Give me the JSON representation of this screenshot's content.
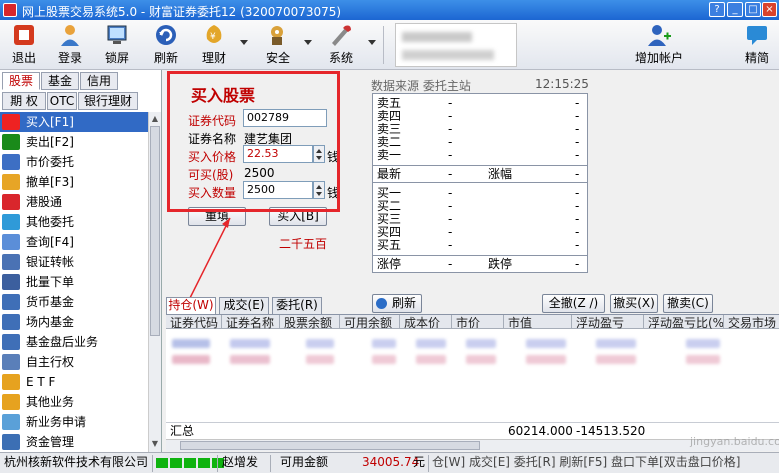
{
  "window": {
    "title": "网上股票交易系统5.0 - 财富证券委托12 (320070073075)"
  },
  "toolbar": {
    "items": [
      {
        "label": "退出",
        "icon": "exit-icon"
      },
      {
        "label": "登录",
        "icon": "login-icon"
      },
      {
        "label": "锁屏",
        "icon": "lock-icon"
      },
      {
        "label": "刷新",
        "icon": "refresh-icon"
      },
      {
        "label": "理财",
        "icon": "wealth-icon"
      },
      {
        "label": "安全",
        "icon": "security-icon"
      },
      {
        "label": "系统",
        "icon": "system-icon"
      }
    ],
    "add_account": "增加帐户",
    "simple": "精简"
  },
  "left_tabs": {
    "row1": [
      "股票",
      "基金",
      "信用"
    ],
    "row2": [
      "期 权",
      "OTC",
      "银行理财"
    ]
  },
  "menu": [
    {
      "label": "买入[F1]",
      "selected": true
    },
    {
      "label": "卖出[F2]"
    },
    {
      "label": "市价委托"
    },
    {
      "label": "撤单[F3]"
    },
    {
      "label": "港股通"
    },
    {
      "label": "其他委托"
    },
    {
      "label": "查询[F4]"
    },
    {
      "label": "银证转帐"
    },
    {
      "label": "批量下单"
    },
    {
      "label": "货币基金"
    },
    {
      "label": "场内基金"
    },
    {
      "label": "基金盘后业务"
    },
    {
      "label": "自主行权"
    },
    {
      "label": "E T F"
    },
    {
      "label": "其他业务"
    },
    {
      "label": "新业务申请"
    },
    {
      "label": "资金管理"
    }
  ],
  "buy_form": {
    "title": "买入股票",
    "code_label": "证券代码",
    "code_value": "002789",
    "name_label": "证券名称",
    "name_value": "建艺集团",
    "price_label": "买入价格",
    "price_value": "22.53",
    "avail_label": "可买(股)",
    "avail_value": "2500",
    "qty_label": "买入数量",
    "qty_value": "2500",
    "unit": "钱",
    "reset_button": "重填",
    "buy_button": "买入[B]",
    "annotation": "二千五百"
  },
  "quote": {
    "header": "数据来源 委托主站",
    "time": "12:15:25",
    "asks": [
      "卖五",
      "卖四",
      "卖三",
      "卖二",
      "卖一"
    ],
    "bids": [
      "买一",
      "买二",
      "买三",
      "买四",
      "买五"
    ],
    "dash": "-",
    "latest": "最新",
    "change": "涨幅",
    "limit_up": "涨停",
    "limit_down": "跌停"
  },
  "bottom_tabs": [
    "持仓(W)",
    "成交(E)",
    "委托(R)"
  ],
  "actions": {
    "refresh": "刷新",
    "cancel_all": "全撤(Z /)",
    "cancel_buy": "撤买(X)",
    "cancel_sell": "撤卖(C)"
  },
  "grid": {
    "columns": [
      "证券代码",
      "证券名称",
      "股票余额",
      "可用余额",
      "成本价",
      "市价",
      "市值",
      "浮动盈亏",
      "浮动盈亏比(%)",
      "交易市场"
    ],
    "total_label": "汇总",
    "total_market_value": "60214.000",
    "total_pnl": "-14513.520"
  },
  "status": {
    "company": "杭州核新软件技术有限公司",
    "user": "赵增发",
    "available_label": "可用金额",
    "available_value": "34005.74",
    "currency": "元",
    "shortcuts": "仓[W] 成交[E] 委托[R] 刷新[F5] 盘口下单[双击盘口价格]"
  },
  "watermark": "jingyan.baidu.com",
  "colors": {
    "accent_red": "#c00000",
    "highlight_box": "#e5262b",
    "selection": "#316ac5",
    "title_bar": "#1c66d2"
  }
}
